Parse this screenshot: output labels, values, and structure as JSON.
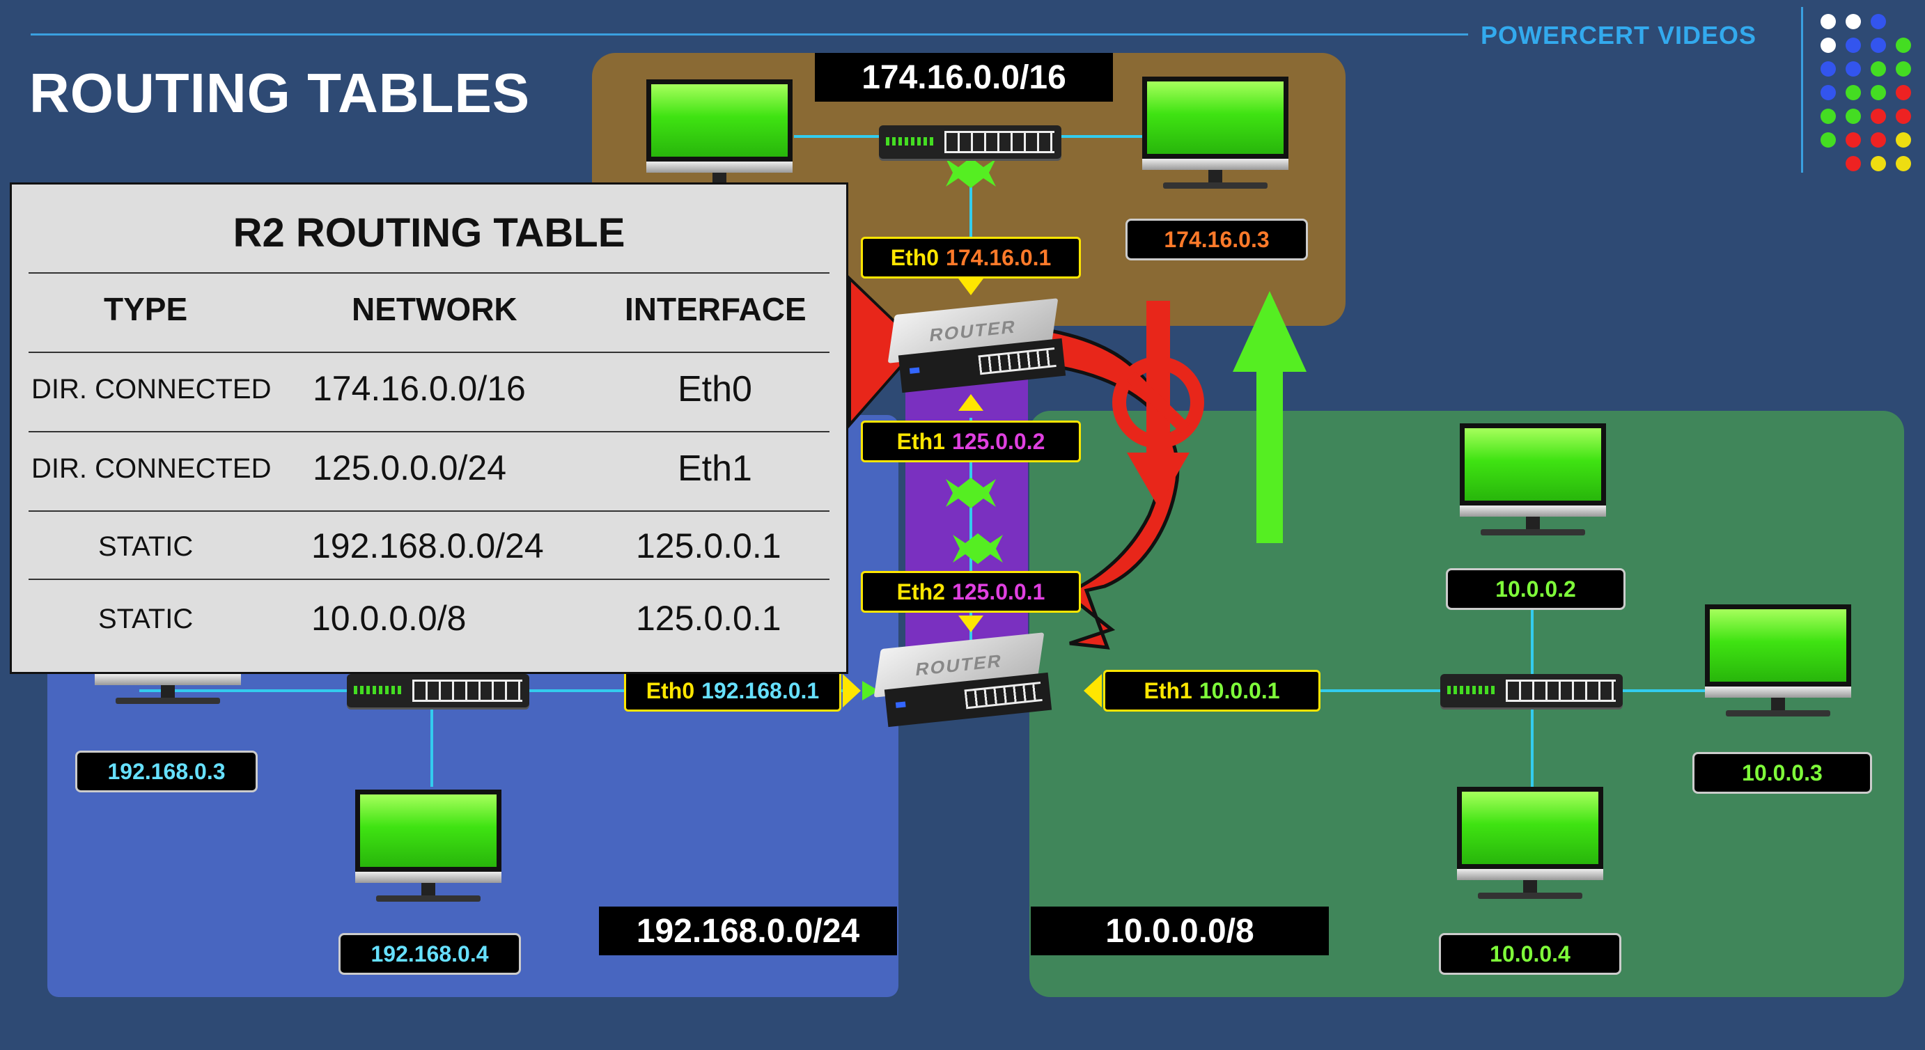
{
  "title": "ROUTING TABLES",
  "brand": "POWERCERT VIDEOS",
  "colors": {
    "background": "#2e4a74",
    "network_top": "#8a6a34",
    "network_left": "#4866c0",
    "network_right": "#40865a",
    "link_middle": "#7a30c0",
    "cable": "#33ccee",
    "screen_green": "#3fe312",
    "arrow_red": "#e8261a",
    "arrow_green": "#55ee22",
    "label_yellow": "#ffe600",
    "text_orange": "#ff7a2a",
    "text_magenta": "#e040e0",
    "text_cyan": "#66e0ff",
    "text_green": "#7fff3a"
  },
  "networks": {
    "top": "174.16.0.0/16",
    "left": "192.168.0.0/24",
    "right": "10.0.0.0/8"
  },
  "hosts": {
    "top_right": "174.16.0.3",
    "left_a": "192.168.0.3",
    "left_b": "192.168.0.4",
    "right_a": "10.0.0.2",
    "right_b": "10.0.0.3",
    "right_c": "10.0.0.4"
  },
  "devices": {
    "router_top_label": "ROUTER",
    "router_bottom_label": "ROUTER"
  },
  "interfaces": {
    "r2_eth0": {
      "name": "Eth0",
      "ip": "174.16.0.1"
    },
    "r2_eth1": {
      "name": "Eth1",
      "ip": "125.0.0.2"
    },
    "r1_eth2": {
      "name": "Eth2",
      "ip": "125.0.0.1"
    },
    "r1_eth0": {
      "name": "Eth0",
      "ip": "192.168.0.1"
    },
    "r1_eth1": {
      "name": "Eth1",
      "ip": "10.0.0.1"
    }
  },
  "routing_table": {
    "title": "R2 ROUTING TABLE",
    "headers": [
      "TYPE",
      "NETWORK",
      "INTERFACE"
    ],
    "rows": [
      [
        "DIR. CONNECTED",
        "174.16.0.0/16",
        "Eth0"
      ],
      [
        "DIR. CONNECTED",
        "125.0.0.0/24",
        "Eth1"
      ],
      [
        "STATIC",
        "192.168.0.0/24",
        "125.0.0.1"
      ],
      [
        "STATIC",
        "10.0.0.0/8",
        "125.0.0.1"
      ]
    ]
  }
}
